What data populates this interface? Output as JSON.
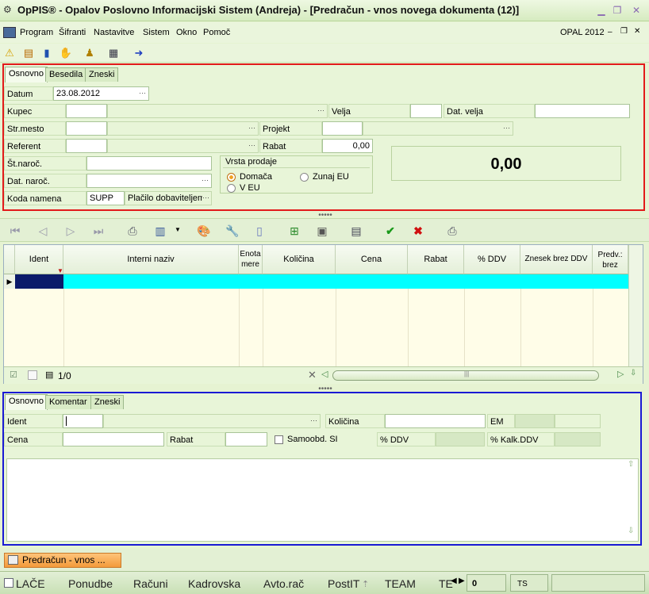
{
  "window": {
    "title": "OpPIS® - Opalov Poslovno Informacijski Sistem  (Andreja) - [Predračun - vnos novega dokumenta (12)]",
    "brand": "OPAL 2012"
  },
  "menu": [
    "Program",
    "Šifranti",
    "Nastavitve",
    "Sistem",
    "Okno",
    "Pomoč"
  ],
  "header_tabs": [
    "Osnovno",
    "Besedila",
    "Zneski"
  ],
  "header_form": {
    "datum_label": "Datum",
    "datum_value": "23.08.2012",
    "kupec_label": "Kupec",
    "velja_label": "Velja",
    "dat_velja_label": "Dat. velja",
    "str_mesto_label": "Str.mesto",
    "projekt_label": "Projekt",
    "referent_label": "Referent",
    "rabat_label": "Rabat",
    "rabat_value": "0,00",
    "st_naroc_label": "Št.naroč.",
    "dat_naroc_label": "Dat. naroč.",
    "koda_namena_label": "Koda namena",
    "koda_namena_value": "SUPP",
    "koda_namena_desc": "Plačilo dobaviteljem",
    "vrsta_prodaje_label": "Vrsta prodaje",
    "radio_domaca": "Domača",
    "radio_zunaj_eu": "Zunaj EU",
    "radio_v_eu": "V EU",
    "total": "0,00"
  },
  "grid": {
    "columns": [
      "Ident",
      "Interni naziv",
      "Enota mere",
      "Količina",
      "Cena",
      "Rabat",
      "% DDV",
      "Znesek brez DDV",
      "Predv.: brez"
    ],
    "record_counter": "1/0"
  },
  "detail_tabs": [
    "Osnovno",
    "Komentar",
    "Zneski"
  ],
  "detail_form": {
    "ident_label": "Ident",
    "kolicina_label": "Količina",
    "em_label": "EM",
    "cena_label": "Cena",
    "rabat_label": "Rabat",
    "samoobd_label": "Samoobd. SI",
    "ddv_label": "% DDV",
    "kalk_ddv_label": "% Kalk.DDV"
  },
  "task_button": "Predračun - vnos ...",
  "status_tabs": [
    "LAČE",
    "Ponudbe",
    "Računi",
    "Kadrovska",
    "Avto.rač",
    "PostIT",
    "TEAM",
    "TE"
  ],
  "status_value": "0",
  "status_ts": "TS",
  "colors": {
    "panel_header": "#e21a1a",
    "panel_detail": "#1a1ad4",
    "selected_row": "#00ffff",
    "task_button": "#f39a3a"
  }
}
